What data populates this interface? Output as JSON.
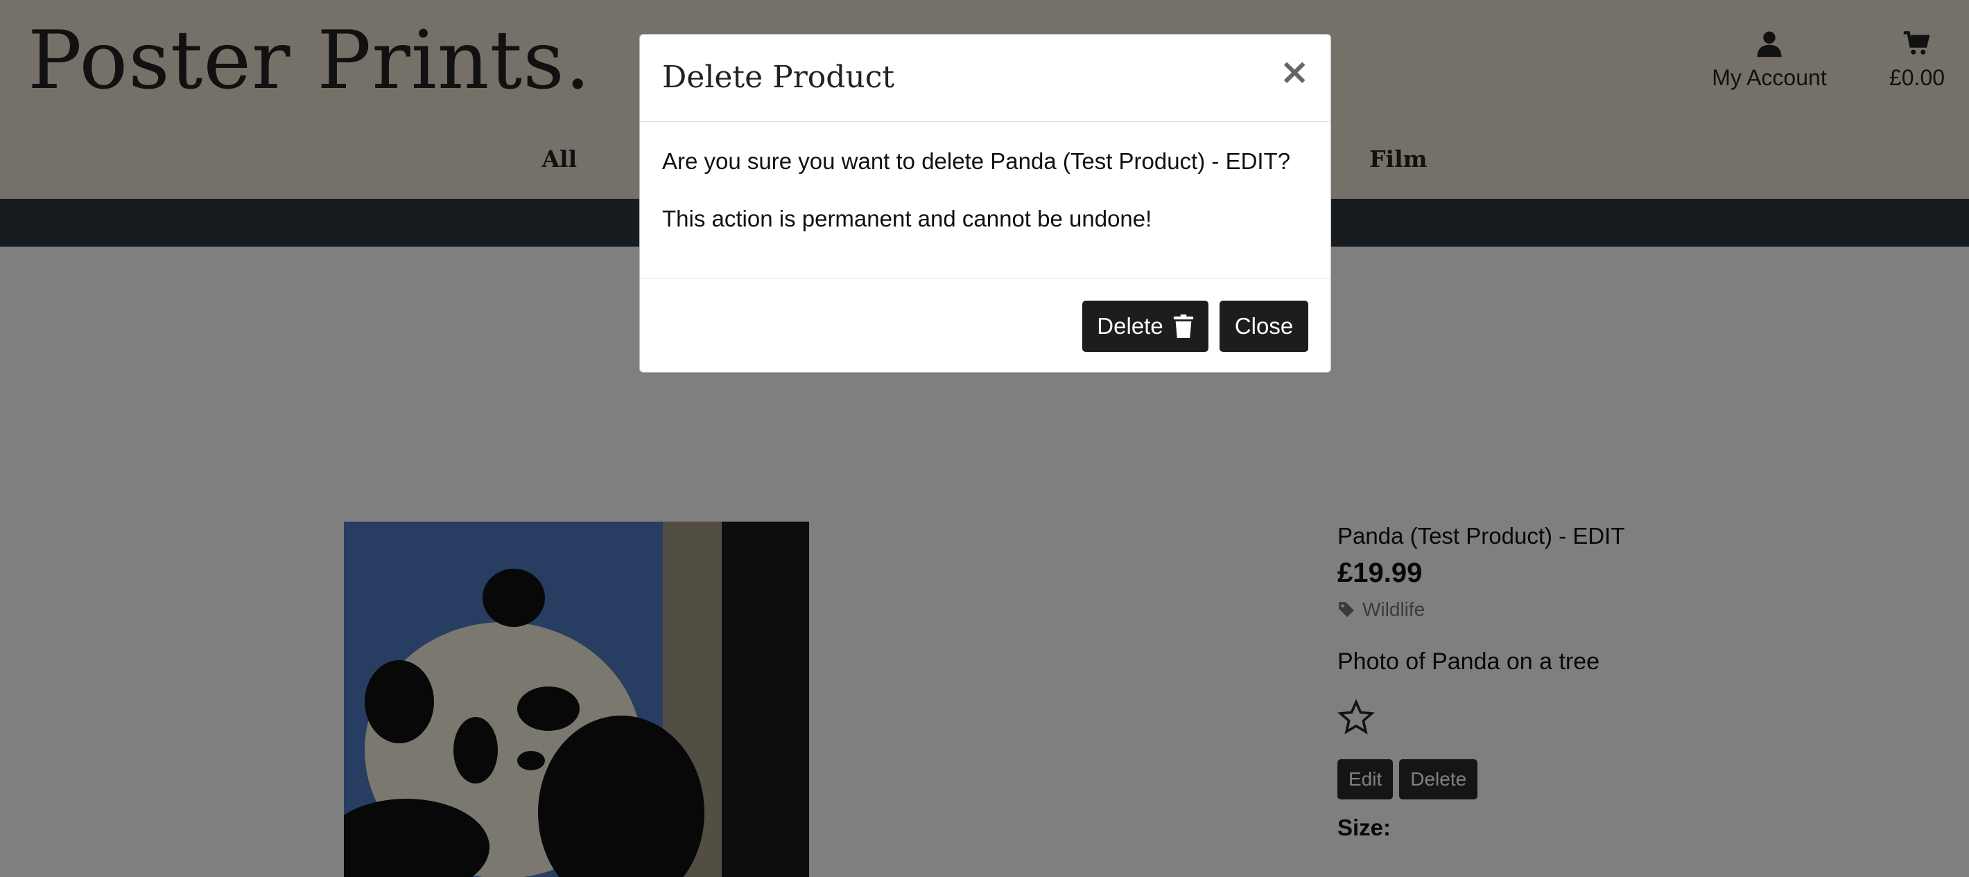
{
  "site": {
    "logo": "Poster Prints.",
    "account_label": "My Account",
    "basket_total": "£0.00",
    "nav": [
      "All",
      "Film"
    ]
  },
  "product": {
    "name": "Panda (Test Product) - EDIT",
    "price": "£19.99",
    "category": "Wildlife",
    "description": "Photo of Panda on a tree",
    "edit_label": "Edit",
    "delete_label": "Delete",
    "size_label": "Size:"
  },
  "modal": {
    "title": "Delete Product",
    "close_symbol": "×",
    "question": "Are you sure you want to delete Panda (Test Product) - EDIT?",
    "warning": "This action is permanent and cannot be undone!",
    "delete_label": "Delete",
    "close_label": "Close"
  },
  "icons": {
    "account": "user-icon",
    "basket": "shopping-cart-icon",
    "category": "tag-icon",
    "rating": "star-outline-icon",
    "delete": "trash-icon",
    "close": "close-icon"
  }
}
